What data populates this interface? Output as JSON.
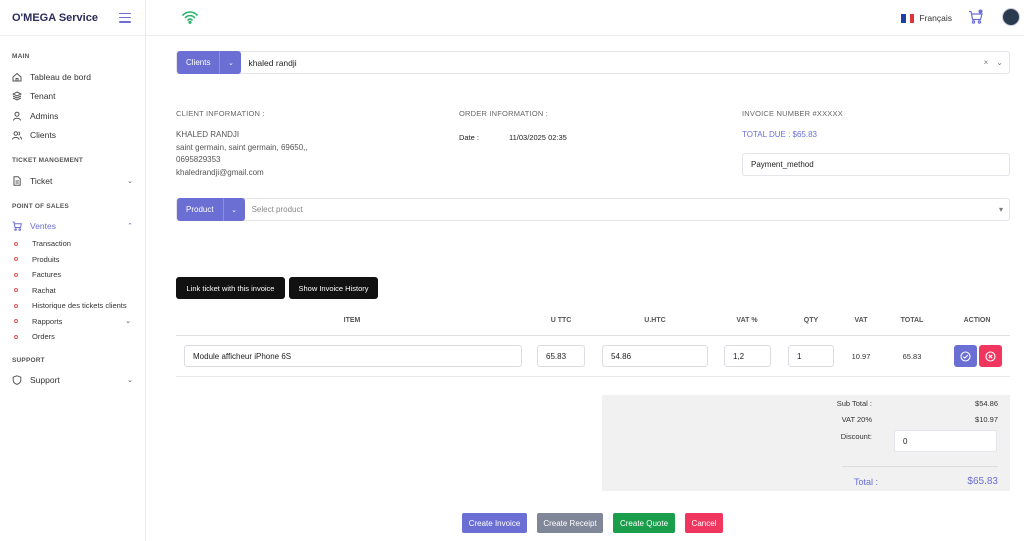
{
  "brand": {
    "name": "O'MEGA Service"
  },
  "sidebar": {
    "sections": {
      "main": "MAIN",
      "ticket": "TICKET MANGEMENT",
      "pos": "POINT OF SALES",
      "support": "SUPPORT"
    },
    "items": {
      "tableau": "Tableau de bord",
      "tenant": "Tenant",
      "admins": "Admins",
      "clients": "Clients",
      "ticket": "Ticket",
      "ventes": "Ventes",
      "support": "Support"
    },
    "sub_items": [
      "Transaction",
      "Produits",
      "Factures",
      "Rachat",
      "Historique des tickets clients",
      "Rapports",
      "Orders"
    ]
  },
  "topbar": {
    "language": "Français",
    "icons": {
      "wifi": "wifi-icon",
      "cart": "cart-icon",
      "avatar": "avatar",
      "flag": "france-flag"
    },
    "colors": {
      "accent": "#6b6fd4",
      "wifi": "#2ab26b"
    }
  },
  "client_select": {
    "button": "Clients",
    "value": "khaled randji",
    "clear": "×",
    "caret": "⌄"
  },
  "client_info": {
    "label": "CLIENT INFORMATION :",
    "name": "KHALED RANDJI",
    "address": "saint germain, saint germain, 69650,,",
    "phone": "0695829353",
    "email": "khaledrandji@gmail.com"
  },
  "order_info": {
    "label": "ORDER INFORMATION :",
    "date_label": "Date :",
    "date_value": "11/03/2025 02:35"
  },
  "invoice_info": {
    "label": "INVOICE NUMBER #XXXXX",
    "total_due": "TOTAL DUE : $65.83",
    "payment_method": "Payment_method"
  },
  "product_select": {
    "button": "Product",
    "placeholder": "Select product"
  },
  "actions": {
    "link_ticket": "Link ticket with this invoice",
    "show_history": "Show Invoice History"
  },
  "table": {
    "headers": [
      "ITEM",
      "U TTC",
      "U.HTC",
      "VAT %",
      "QTY",
      "VAT",
      "TOTAL",
      "ACTION"
    ],
    "row": {
      "item": "Module afficheur iPhone 6S",
      "u_ttc": "65.83",
      "u_htc": "54.86",
      "vat_pct": "1,2",
      "qty": "1",
      "vat": "10.97",
      "total": "65.83"
    }
  },
  "summary": {
    "subtotal_label": "Sub Total :",
    "subtotal_value": "$54.86",
    "vat_label": "VAT 20%",
    "vat_value": "$10.97",
    "discount_label": "Discount:",
    "discount_value": "0",
    "total_label": "Total :",
    "total_value": "$65.83"
  },
  "buttons": {
    "create_invoice": "Create Invoice",
    "create_receipt": "Create Receipt",
    "create_quote": "Create Quote",
    "cancel": "Cancel"
  },
  "button_colors": {
    "create_invoice": "#6b6fd4",
    "create_receipt": "#7f8799",
    "create_quote": "#1a9e4b",
    "cancel": "#f0365f"
  }
}
